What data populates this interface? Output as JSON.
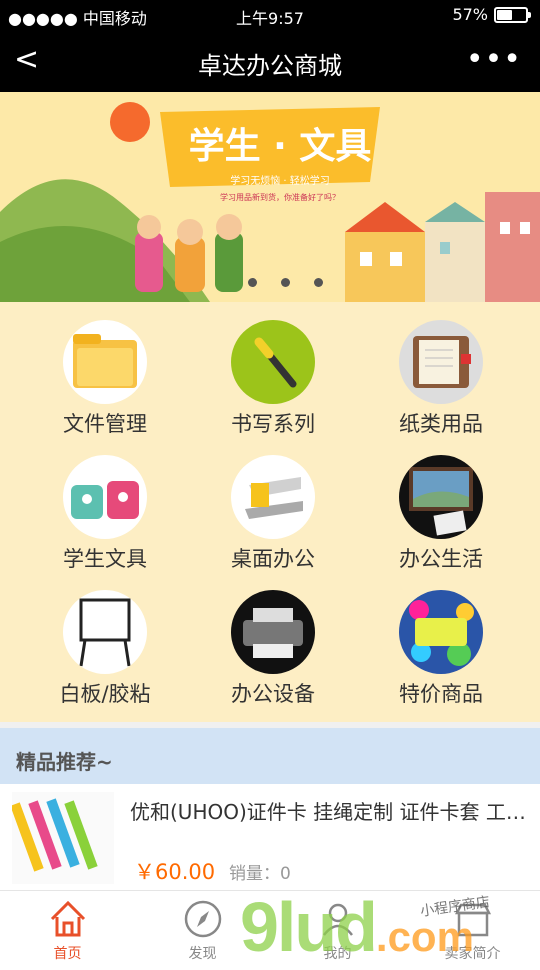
{
  "status_bar": {
    "carrier": "●●●●● 中国移动",
    "time": "上午9:57",
    "battery": "57%",
    "battery_level": 0.57
  },
  "nav": {
    "back": "<",
    "title": "卓达办公商城",
    "more": "•••"
  },
  "banner": {
    "title": "学生 · 文具",
    "subtitle": "学习无烦恼 · 轻松学习",
    "tagline": "学习用品新到货，你准备好了吗？",
    "slides": 3
  },
  "categories": [
    {
      "label": "文件管理",
      "icon": "folder-icon"
    },
    {
      "label": "书写系列",
      "icon": "pen-icon"
    },
    {
      "label": "纸类用品",
      "icon": "notebook-icon"
    },
    {
      "label": "学生文具",
      "icon": "sharpener-icon"
    },
    {
      "label": "桌面办公",
      "icon": "stapler-icon"
    },
    {
      "label": "办公生活",
      "icon": "photo-frame-icon"
    },
    {
      "label": "白板/胶粘",
      "icon": "whiteboard-icon"
    },
    {
      "label": "办公设备",
      "icon": "printer-icon"
    },
    {
      "label": "特价商品",
      "icon": "special-offer-icon"
    }
  ],
  "section": {
    "title": "精品推荐~"
  },
  "products": [
    {
      "name": "优和(UHOO)证件卡 挂绳定制 证件卡套 工作证",
      "price": "￥60.00",
      "sales": "销量：0"
    }
  ],
  "tabs": [
    {
      "label": "首页",
      "icon": "home-icon",
      "active": true
    },
    {
      "label": "发现",
      "icon": "compass-icon",
      "active": false
    },
    {
      "label": "我的",
      "icon": "user-icon",
      "active": false
    },
    {
      "label": "卖家简介",
      "icon": "shop-icon",
      "active": false
    }
  ],
  "watermark": {
    "main": "9lud",
    "suffix": ".com",
    "script": "小程序商店"
  },
  "colors": {
    "accent": "#ff6a00",
    "active_tab": "#e8502a",
    "category_bg": "#fdeec4",
    "section_bg": "#d2e3f5"
  }
}
